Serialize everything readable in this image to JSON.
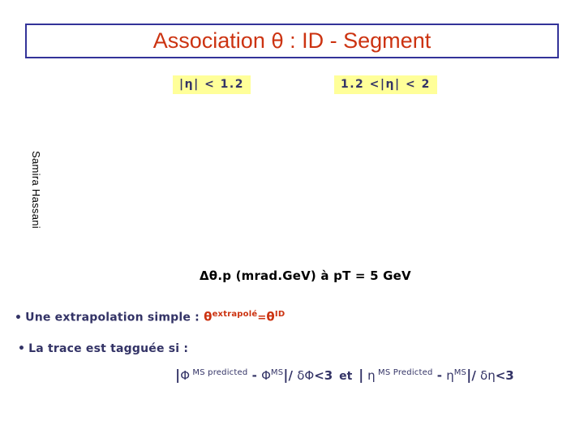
{
  "slide": {
    "background_color": "#ffffff",
    "title": {
      "text": "Association θ : ID - Segment",
      "prefix": "Association ",
      "symbol": "θ",
      "suffix": " : ID - Segment",
      "color": "#cc3311",
      "border_color": "#333399"
    },
    "eta_labels": [
      {
        "text": "|η| < 1.2",
        "bg_color": "#ffff99",
        "text_color": "#333366"
      },
      {
        "text": "1.2 <|η| < 2",
        "bg_color": "#ffff99",
        "text_color": "#333366"
      }
    ],
    "author": {
      "name": "Samira Hassani",
      "color": "#000000"
    },
    "plot_caption": {
      "text": "Δθ.p  (mrad.GeV) à pT = 5 GeV",
      "color": "#000000"
    },
    "bullets": [
      {
        "dot": "•",
        "text": "Une extrapolation simple  : ",
        "formula": {
          "symbol_1": "θ",
          "sup_1": "extrapolé",
          "operator": "=",
          "symbol_2": "θ",
          "sup_2": "ID",
          "color": "#cc3311"
        }
      },
      {
        "dot": "•",
        "text": "La trace est tagguée si :",
        "formula": null
      }
    ],
    "condition_formula": {
      "color": "#333366",
      "parts": [
        {
          "type": "bar",
          "text": "|"
        },
        {
          "type": "greek",
          "text": "Φ"
        },
        {
          "type": "sup",
          "text": " MS predicted"
        },
        {
          "type": "op",
          "text": " - "
        },
        {
          "type": "greek",
          "text": "Φ"
        },
        {
          "type": "sup",
          "text": "MS"
        },
        {
          "type": "bar",
          "text": "|"
        },
        {
          "type": "op",
          "text": "/ "
        },
        {
          "type": "greek",
          "text": "δΦ"
        },
        {
          "type": "num",
          "text": "<3"
        },
        {
          "type": "et",
          "text": " et "
        },
        {
          "type": "bar",
          "text": "|"
        },
        {
          "type": "greek",
          "text": " η"
        },
        {
          "type": "sup",
          "text": " MS Predicted"
        },
        {
          "type": "op",
          "text": " - "
        },
        {
          "type": "greek",
          "text": "η"
        },
        {
          "type": "sup",
          "text": "MS"
        },
        {
          "type": "bar",
          "text": "|"
        },
        {
          "type": "op",
          "text": "/ "
        },
        {
          "type": "greek",
          "text": "δη"
        },
        {
          "type": "num",
          "text": "<3"
        }
      ]
    }
  }
}
